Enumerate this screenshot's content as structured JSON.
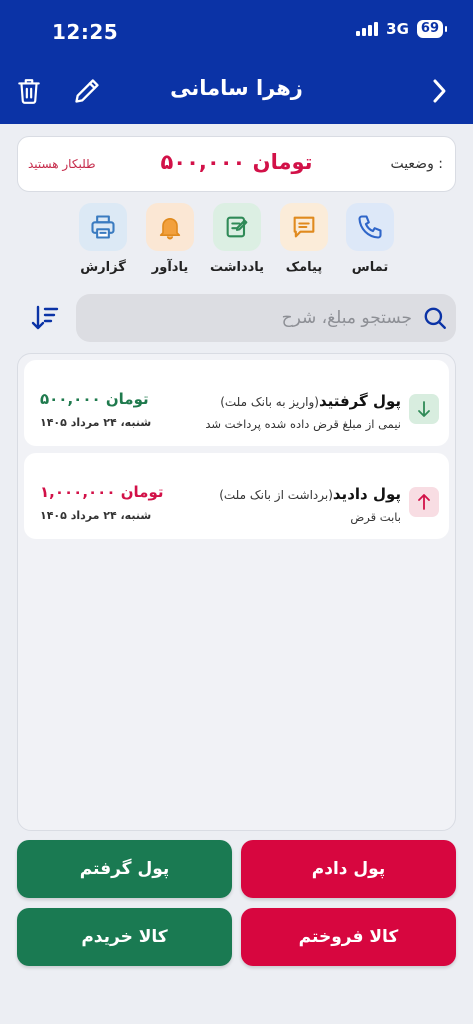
{
  "status_bar": {
    "time": "12:25",
    "network": "3G",
    "battery": "69"
  },
  "header": {
    "title": "زهرا سامانی"
  },
  "status": {
    "label": "وضعیت :",
    "amount": "۵۰۰,۰۰۰ تومان",
    "note": "طلبکار هستید"
  },
  "actions": [
    {
      "label": "تماس",
      "icon": "phone-icon"
    },
    {
      "label": "پیامک",
      "icon": "message-icon"
    },
    {
      "label": "یادداشت",
      "icon": "note-icon"
    },
    {
      "label": "یادآور",
      "icon": "bell-icon"
    },
    {
      "label": "گزارش",
      "icon": "printer-icon"
    }
  ],
  "search": {
    "placeholder": "جستجو مبلغ، شرح"
  },
  "transactions": [
    {
      "title": "پول گرفتید",
      "subtitle": "(واریز به بانک ملت)",
      "description": "نیمی از مبلغ قرض داده شده پرداخت شد",
      "amount": "۵۰۰,۰۰۰ تومان",
      "date": "شنبه، ۲۴ مرداد ۱۴۰۵",
      "direction": "in",
      "color": "#1f7a4d"
    },
    {
      "title": "پول دادید",
      "subtitle": "(برداشت از بانک ملت)",
      "description": "بابت قرض",
      "amount": "۱,۰۰۰,۰۰۰ تومان",
      "date": "شنبه، ۲۴ مرداد ۱۴۰۵",
      "direction": "out",
      "color": "#d21148"
    }
  ],
  "buttons": {
    "gave_money": "پول دادم",
    "got_money": "پول گرفتم",
    "sold_goods": "کالا فروختم",
    "bought_goods": "کالا خریدم"
  },
  "colors": {
    "primary": "#0b33a6",
    "red": "#d21148",
    "green": "#1a7a52"
  }
}
